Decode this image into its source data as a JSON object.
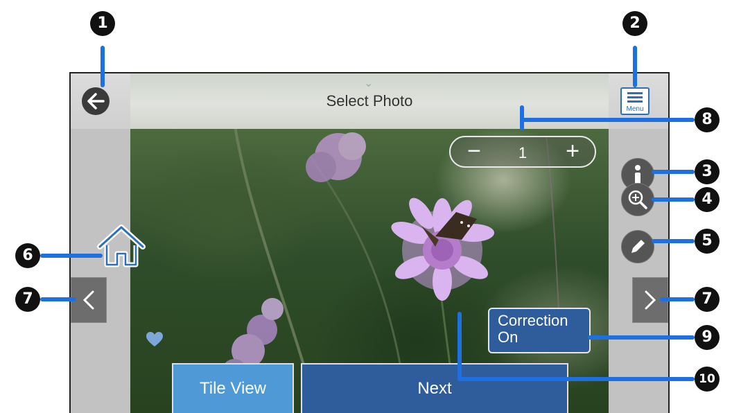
{
  "header": {
    "title": "Select Photo"
  },
  "menu": {
    "label": "Menu"
  },
  "stepper": {
    "minus": "−",
    "count": "1",
    "plus": "+"
  },
  "buttons": {
    "correction_line1": "Correction",
    "correction_line2": "On",
    "tile_view": "Tile View",
    "next": "Next"
  },
  "callouts": [
    "1",
    "2",
    "3",
    "4",
    "5",
    "6",
    "7",
    "7",
    "8",
    "9",
    "10"
  ],
  "colors": {
    "accent_blue": "#2f5d9c",
    "tile_blue": "#4f9ad6",
    "leader_blue": "#1e6fe0",
    "heart": "#7ea6d8"
  },
  "icons": [
    "back-arrow-icon",
    "menu-icon",
    "info-icon",
    "zoom-in-icon",
    "pencil-icon",
    "home-icon",
    "chevron-left-icon",
    "chevron-right-icon",
    "heart-icon"
  ]
}
